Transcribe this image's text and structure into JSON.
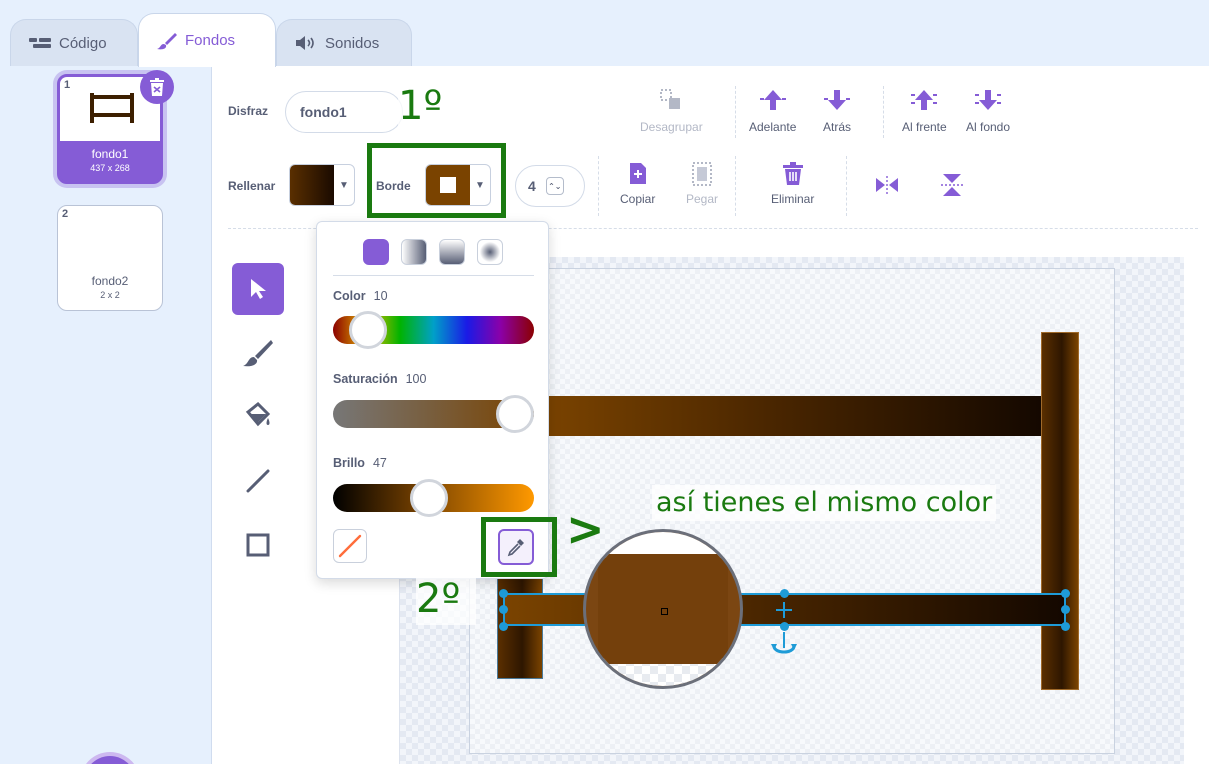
{
  "tabs": [
    {
      "label": "Código",
      "icon": "code-icon"
    },
    {
      "label": "Fondos",
      "icon": "brush-icon"
    },
    {
      "label": "Sonidos",
      "icon": "speaker-icon"
    }
  ],
  "sidebar": {
    "costumes": [
      {
        "num": "1",
        "name": "fondo1",
        "size": "437 x 268"
      },
      {
        "num": "2",
        "name": "fondo2",
        "size": "2 x 2"
      }
    ]
  },
  "toolbar": {
    "costume_label": "Disfraz",
    "costume_name": "fondo1",
    "fill_label": "Rellenar",
    "outline_label": "Borde",
    "outline_width": "4",
    "ungroup": "Desagrupar",
    "forward": "Adelante",
    "backward": "Atrás",
    "front": "Al frente",
    "back": "Al fondo",
    "copy": "Copiar",
    "paste": "Pegar",
    "delete": "Eliminar"
  },
  "picker": {
    "color_label": "Color",
    "color_value": "10",
    "saturation_label": "Saturación",
    "saturation_value": "100",
    "brightness_label": "Brillo",
    "brightness_value": "47",
    "color_fraction": 0.1,
    "saturation_fraction": 1.0,
    "brightness_fraction": 0.47
  },
  "annotations": {
    "step1": "1º",
    "step2": "2º",
    "note": "así tienes el mismo color",
    "arrow": ">"
  },
  "colors": {
    "accent": "#855cd6",
    "annotation_green": "#1a7a10",
    "outline_brown": "#7a4300",
    "selection_blue": "#1e9bd7"
  }
}
